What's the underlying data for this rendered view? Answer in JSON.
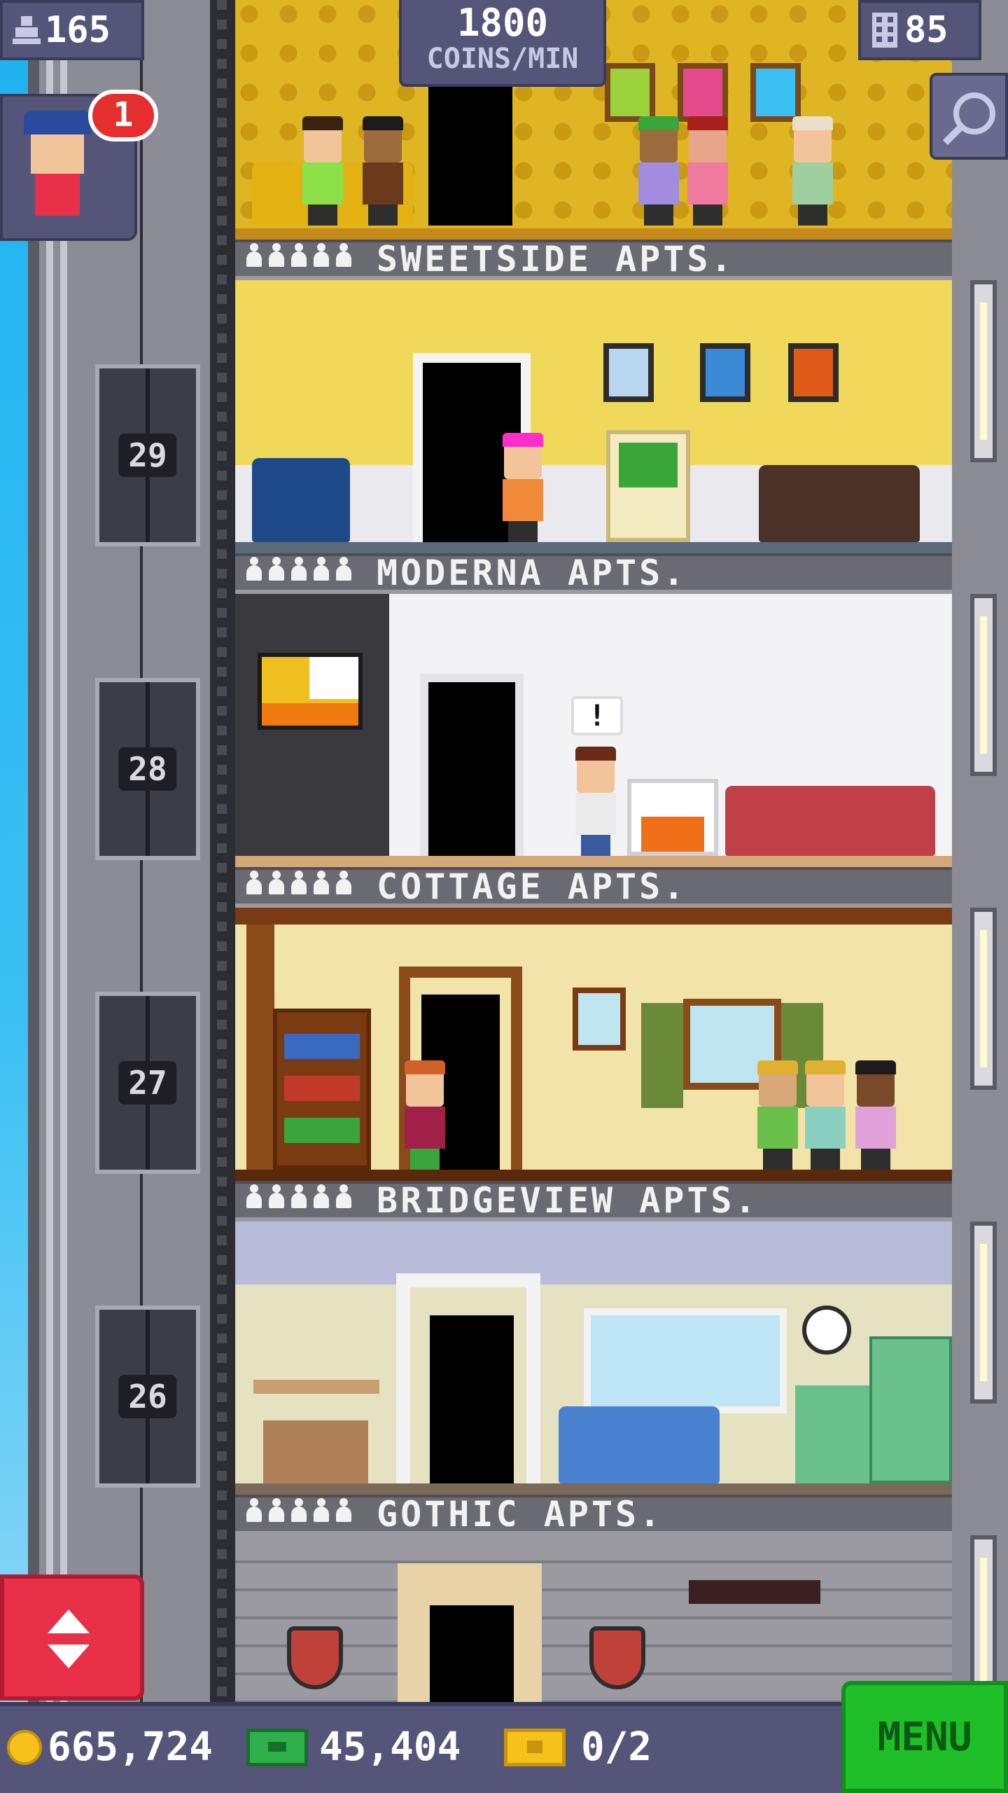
{
  "hud": {
    "population": "165",
    "coins_rate": "1800",
    "coins_rate_unit": "COINS/MIN",
    "floors": "85",
    "notification_count": "1"
  },
  "floors": [
    {
      "name": "SWEETSIDE APTS.",
      "theme": "gold"
    },
    {
      "name": "MODERNA APTS.",
      "theme": "yellow"
    },
    {
      "name": "COTTAGE APTS.",
      "theme": "white"
    },
    {
      "name": "BRIDGEVIEW APTS.",
      "theme": "wood"
    },
    {
      "name": "GOTHIC APTS.",
      "theme": "green"
    }
  ],
  "elevator_floor_numbers": [
    "29",
    "28",
    "27",
    "26"
  ],
  "speech_bubble": "!",
  "bottom": {
    "coins": "665,724",
    "bux": "45,404",
    "tickets": "0/2",
    "menu_label": "MENU"
  },
  "colors": {
    "hud_bg": "#55557a",
    "menu_green": "#1fbf2a",
    "elevator_button_red": "#e83048",
    "badge_red": "#e52e2e",
    "coin_gold": "#f4c21b"
  },
  "icons": [
    "person-icon",
    "building-icon",
    "search-icon",
    "coin-icon",
    "bux-icon",
    "ticket-icon",
    "up-down-arrows-icon"
  ]
}
